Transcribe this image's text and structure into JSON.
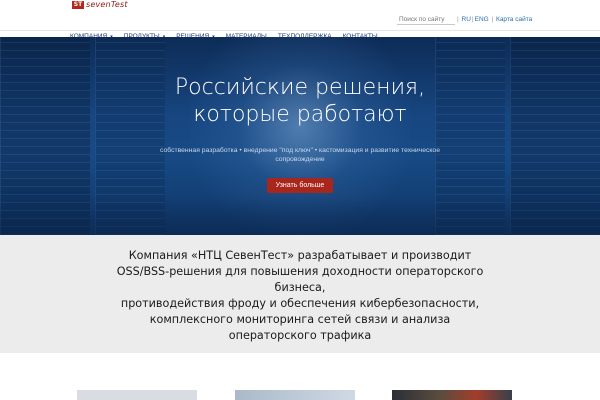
{
  "header": {
    "logo_mark": "ST",
    "logo_text": "sevenTest",
    "search_placeholder": "Поиск по сайту",
    "lang_ru": "RU",
    "lang_en": "ENG",
    "sitemap": "Карта сайта"
  },
  "nav": {
    "items": [
      {
        "label": "КОМПАНИЯ",
        "caret": "▾"
      },
      {
        "label": "ПРОДУКТЫ",
        "caret": "▾"
      },
      {
        "label": "РЕШЕНИЯ",
        "caret": "▾"
      },
      {
        "label": "МАТЕРИАЛЫ",
        "caret": ""
      },
      {
        "label": "ТЕХПОДДЕРЖКА",
        "caret": ""
      },
      {
        "label": "КОНТАКТЫ",
        "caret": ""
      }
    ]
  },
  "hero": {
    "title_line1": "Российские решения,",
    "title_line2": "которые работают",
    "subtitle": "собственная разработка • внедрение \"под ключ\" • кастомизация и развитие техническое сопровождение",
    "button": "Узнать больше"
  },
  "intro": {
    "line1": "Компания «НТЦ СевенТест» разрабатывает и производит",
    "line2": "OSS/BSS-решения для повышения доходности операторского",
    "line3": "бизнеса,",
    "line4": "противодействия фроду и обеспечения кибербезопасности,",
    "line5": "комплексного мониторинга сетей связи и анализа",
    "line6": "операторского трафика"
  },
  "colors": {
    "accent": "#a8261c",
    "nav_text": "#1e3b6b",
    "hero_bg": "#174680",
    "intro_bg": "#ececec"
  }
}
